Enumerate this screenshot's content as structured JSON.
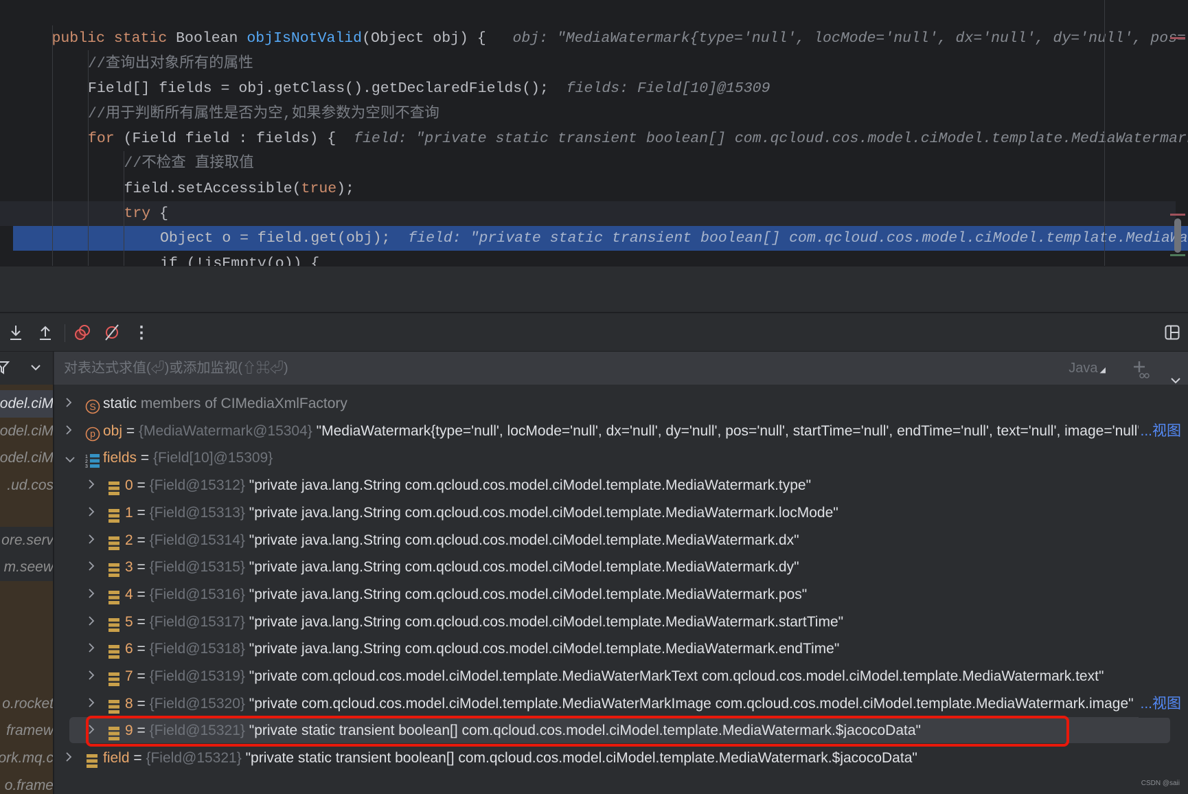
{
  "editor": {
    "lines": [
      [
        [
          "public static ",
          "k"
        ],
        [
          "Boolean ",
          "t"
        ],
        [
          "objIsNotValid",
          "m"
        ],
        [
          "(Object obj) {",
          "t"
        ],
        [
          "   obj: \"MediaWatermark{type='null', locMode='null', dx='null', dy='null', pos='null', startTime='null', endTime='null'",
          "h"
        ]
      ],
      [
        [
          "//查询出对象所有的属性",
          "c"
        ]
      ],
      [
        [
          "Field[] fields = obj.getClass().getDeclaredFields();",
          "t"
        ],
        [
          "  fields: Field[10]@15309",
          "h"
        ]
      ],
      [
        [
          "//用于判断所有属性是否为空,如果参数为空则不查询",
          "c"
        ]
      ],
      [
        [
          "for ",
          "k"
        ],
        [
          "(Field field : fields) {",
          "t"
        ],
        [
          "  field: \"private static transient boolean[] com.qcloud.cos.model.ciModel.template.MediaWatermark.$jacocoData\"",
          "h"
        ]
      ],
      [
        [
          "//不检查 直接取值",
          "c"
        ]
      ],
      [
        [
          "field.setAccessible(",
          "t"
        ],
        [
          "true",
          "k"
        ],
        [
          ");",
          "t"
        ]
      ],
      [
        [
          "try",
          "k"
        ],
        [
          " {",
          "t"
        ]
      ],
      [
        [
          "Object o = field.get(obj);",
          "t"
        ],
        [
          "  field: \"private static transient boolean[] com.qcloud.cos.model.ciModel.template.MediaWatermark.$jacocoData\"",
          "h"
        ]
      ],
      [
        [
          "if (!isEmpty(o)) {",
          "t"
        ]
      ]
    ],
    "indents": [
      1,
      2,
      2,
      2,
      2,
      3,
      3,
      3,
      4,
      4
    ]
  },
  "toolbar": {
    "icons": [
      "step-into-icon",
      "step-out-icon",
      "view-breakpoints-icon",
      "mute-breakpoints-icon",
      "more-icon",
      "layout-icon"
    ]
  },
  "watch": {
    "placeholder": "对表达式求值(⏎)或添加监视(⇧⌘⏎)",
    "language": "Java"
  },
  "frames": [
    {
      "label": "odel.ciM",
      "style": "sel"
    },
    {
      "label": "odel.ciM",
      "style": "lib"
    },
    {
      "label": "odel.ciM",
      "style": "lib"
    },
    {
      "label": "ud.cos.",
      "style": "lib"
    },
    {
      "label": "",
      "style": "lib"
    },
    {
      "label": "ore.serv",
      "style": "lib-gray"
    },
    {
      "label": "m.seew",
      "style": "lib-gray"
    },
    {
      "label": "",
      "style": "lib"
    },
    {
      "label": "",
      "style": "lib"
    },
    {
      "label": "",
      "style": "lib"
    },
    {
      "label": "",
      "style": "lib"
    },
    {
      "label": "o.rocket",
      "style": "lib"
    },
    {
      "label": "framew",
      "style": "lib"
    },
    {
      "label": "ork.mq.c",
      "style": "lib"
    },
    {
      "label": "o.frame",
      "style": "lib"
    }
  ],
  "variables": [
    {
      "level": 0,
      "expanded": false,
      "icon": "static",
      "name": "static",
      "rest": " members of CIMediaXmlFactory"
    },
    {
      "level": 0,
      "expanded": false,
      "icon": "param",
      "name": "obj",
      "ref": "{MediaWatermark@15304}",
      "value": "\"MediaWatermark{type='null', locMode='null', dx='null', dy='null', pos='null', startTime='null', endTime='null', text='null', image='null'}\"",
      "link": "...视图"
    },
    {
      "level": 0,
      "expanded": true,
      "icon": "array",
      "name": "fields",
      "ref": "{Field[10]@15309}",
      "value": ""
    },
    {
      "level": 1,
      "expanded": false,
      "icon": "field",
      "name": "0",
      "ref": "{Field@15312}",
      "value": "\"private java.lang.String com.qcloud.cos.model.ciModel.template.MediaWatermark.type\""
    },
    {
      "level": 1,
      "expanded": false,
      "icon": "field",
      "name": "1",
      "ref": "{Field@15313}",
      "value": "\"private java.lang.String com.qcloud.cos.model.ciModel.template.MediaWatermark.locMode\""
    },
    {
      "level": 1,
      "expanded": false,
      "icon": "field",
      "name": "2",
      "ref": "{Field@15314}",
      "value": "\"private java.lang.String com.qcloud.cos.model.ciModel.template.MediaWatermark.dx\""
    },
    {
      "level": 1,
      "expanded": false,
      "icon": "field",
      "name": "3",
      "ref": "{Field@15315}",
      "value": "\"private java.lang.String com.qcloud.cos.model.ciModel.template.MediaWatermark.dy\""
    },
    {
      "level": 1,
      "expanded": false,
      "icon": "field",
      "name": "4",
      "ref": "{Field@15316}",
      "value": "\"private java.lang.String com.qcloud.cos.model.ciModel.template.MediaWatermark.pos\""
    },
    {
      "level": 1,
      "expanded": false,
      "icon": "field",
      "name": "5",
      "ref": "{Field@15317}",
      "value": "\"private java.lang.String com.qcloud.cos.model.ciModel.template.MediaWatermark.startTime\""
    },
    {
      "level": 1,
      "expanded": false,
      "icon": "field",
      "name": "6",
      "ref": "{Field@15318}",
      "value": "\"private java.lang.String com.qcloud.cos.model.ciModel.template.MediaWatermark.endTime\""
    },
    {
      "level": 1,
      "expanded": false,
      "icon": "field",
      "name": "7",
      "ref": "{Field@15319}",
      "value": "\"private com.qcloud.cos.model.ciModel.template.MediaWaterMarkText com.qcloud.cos.model.ciModel.template.MediaWatermark.text\""
    },
    {
      "level": 1,
      "expanded": false,
      "icon": "field",
      "name": "8",
      "ref": "{Field@15320}",
      "value": "\"private com.qcloud.cos.model.ciModel.template.MediaWaterMarkImage com.qcloud.cos.model.ciModel.template.MediaWatermark.image\"",
      "link": "...视图"
    },
    {
      "level": 1,
      "expanded": false,
      "icon": "field",
      "name": "9",
      "ref": "{Field@15321}",
      "value": "\"private static transient boolean[] com.qcloud.cos.model.ciModel.template.MediaWatermark.$jacocoData\"",
      "selected": true
    },
    {
      "level": 0,
      "expanded": false,
      "icon": "field",
      "name": "field",
      "ref": "{Field@15321}",
      "value": "\"private static transient boolean[] com.qcloud.cos.model.ciModel.template.MediaWatermark.$jacocoData\""
    }
  ],
  "watermark": "CSDN @saii",
  "colors": {
    "execution_line": "#2a4d8f",
    "highlight_box": "#e8190b",
    "link": "#548af7",
    "library_frame": "#3c3226"
  }
}
